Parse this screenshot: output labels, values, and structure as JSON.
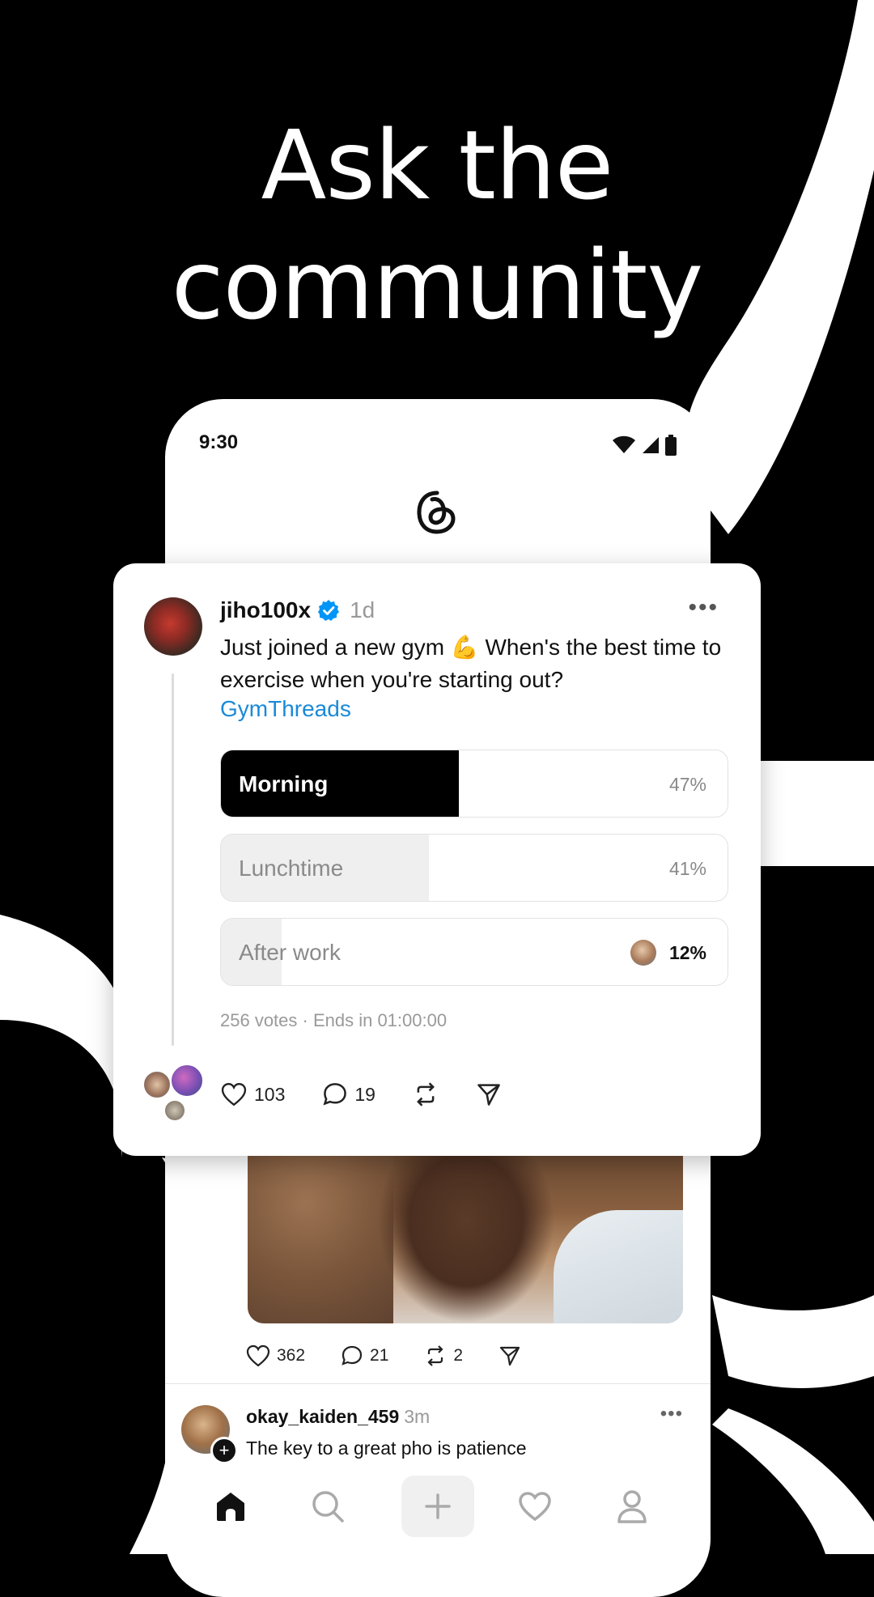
{
  "headline": {
    "line1": "Ask the",
    "line2": "community"
  },
  "status_bar": {
    "time": "9:30"
  },
  "featured_post": {
    "username": "jiho100x",
    "time": "1d",
    "text": "Just joined a new gym 💪 When's the best time to exercise when you're starting out?",
    "hashtag": "GymThreads",
    "poll": {
      "options": [
        {
          "label": "Morning",
          "percent_text": "47%",
          "percent": 47,
          "selected": true
        },
        {
          "label": "Lunchtime",
          "percent_text": "41%",
          "percent": 41,
          "selected": false
        },
        {
          "label": "After work",
          "percent_text": "12%",
          "percent": 12,
          "selected": false
        }
      ],
      "meta": "256 votes · Ends in 01:00:00"
    },
    "likes": "103",
    "replies": "19"
  },
  "image_post": {
    "likes": "362",
    "replies": "21",
    "reposts": "2"
  },
  "next_post": {
    "username": "okay_kaiden_459",
    "time": "3m",
    "text": "The key to a great pho is patience"
  },
  "icons": {
    "verified": "verified-badge-icon",
    "like": "heart-icon",
    "reply": "comment-icon",
    "repost": "repost-icon",
    "share": "send-icon",
    "nav": [
      "home-icon",
      "search-icon",
      "plus-icon",
      "heart-icon",
      "profile-icon"
    ]
  },
  "colors": {
    "accent_link": "#1a8ad8",
    "verified": "#0095f6",
    "poll_selected": "#000000",
    "poll_unselected": "#efefef"
  }
}
